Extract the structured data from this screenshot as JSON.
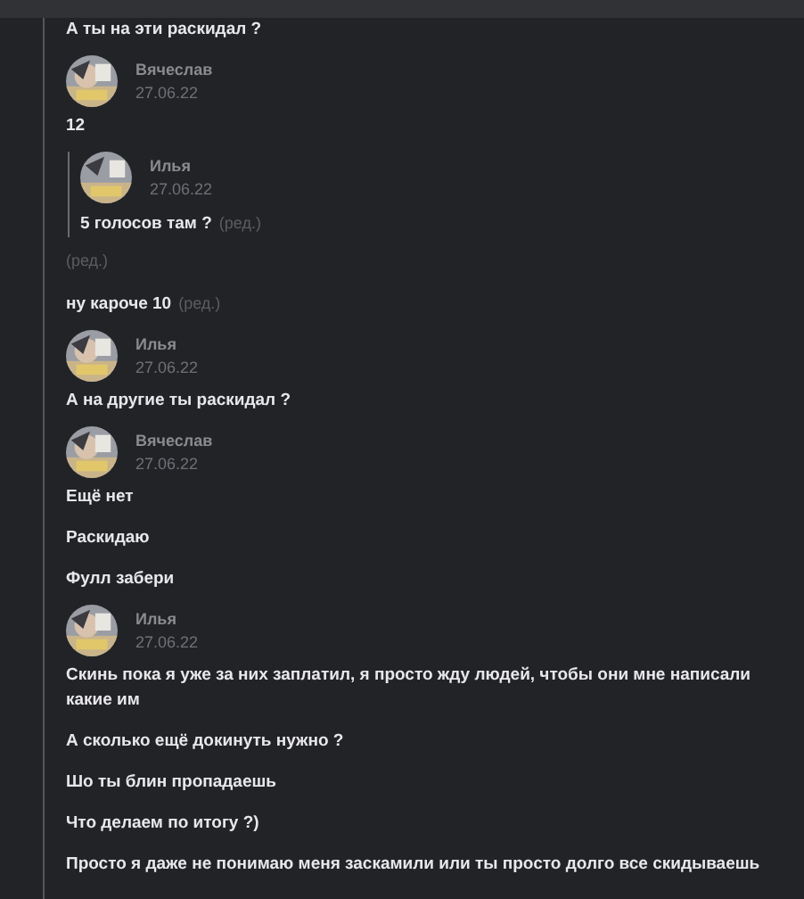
{
  "messages": [
    {
      "kind": "text",
      "text": "А ты на эти раскидал ?"
    },
    {
      "kind": "header",
      "author": "Вячеслав",
      "date": "27.06.22"
    },
    {
      "kind": "text",
      "text": "12"
    },
    {
      "kind": "quote",
      "author": "Илья",
      "date": "27.06.22",
      "text": "5 голосов там ?",
      "edited": true,
      "edited_label": "(ред.)"
    },
    {
      "kind": "edited",
      "label": "(ред.)"
    },
    {
      "kind": "text",
      "text": "ну кароче 10",
      "edited": true,
      "edited_label": "(ред.)"
    },
    {
      "kind": "header",
      "author": "Илья",
      "date": "27.06.22"
    },
    {
      "kind": "text",
      "text": "А на другие ты раскидал ?"
    },
    {
      "kind": "header",
      "author": "Вячеслав",
      "date": "27.06.22"
    },
    {
      "kind": "text",
      "text": "Ещё нет"
    },
    {
      "kind": "text",
      "text": "Раскидаю"
    },
    {
      "kind": "text",
      "text": "Фулл забери"
    },
    {
      "kind": "header",
      "author": "Илья",
      "date": "27.06.22"
    },
    {
      "kind": "text",
      "text": "Скинь пока я уже за них заплатил, я просто жду людей, чтобы они мне написали какие им"
    },
    {
      "kind": "text",
      "text": "А сколько ещё докинуть нужно ?"
    },
    {
      "kind": "text",
      "text": "Шо ты блин пропадаешь"
    },
    {
      "kind": "text",
      "text": "Что делаем по итогу ?)"
    },
    {
      "kind": "text",
      "text": "Просто я даже не понимаю меня заскамили или ты просто долго все скидываешь"
    }
  ]
}
